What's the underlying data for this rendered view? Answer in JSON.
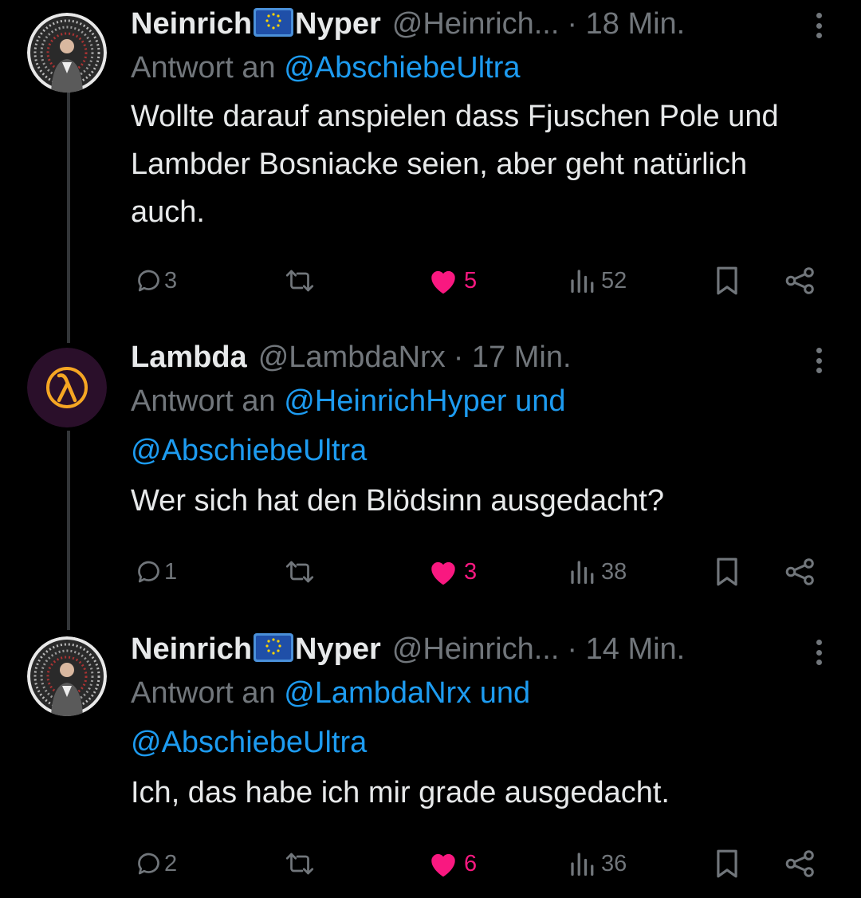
{
  "tweets": [
    {
      "name_a": "Neinrich",
      "name_b": "Nyper",
      "handle": "@Heinrich...",
      "time": "· 18 Min.",
      "reply_prefix": "Antwort an",
      "reply_mentions": "@AbschiebeUltra",
      "reply_line2": "",
      "text": "Wollte darauf anspielen dass Fjuschen Pole und Lambder Bosniacke seien, aber geht natürlich auch.",
      "replies": "3",
      "likes": "5",
      "views": "52",
      "avatar_icon": "avatar-dotted-circle-icon"
    },
    {
      "name_a": "Lambda",
      "handle": "@LambdaNrx",
      "time": "· 17 Min.",
      "reply_prefix": "Antwort an",
      "reply_mentions": "@HeinrichHyper und",
      "reply_line2": "@AbschiebeUltra",
      "text": "Wer sich hat den Blödsinn ausgedacht?",
      "replies": "1",
      "likes": "3",
      "views": "38",
      "avatar_icon": "lambda-icon"
    },
    {
      "name_a": "Neinrich",
      "name_b": "Nyper",
      "handle": "@Heinrich...",
      "time": "· 14 Min.",
      "reply_prefix": "Antwort an",
      "reply_mentions": "@LambdaNrx und",
      "reply_line2": "@AbschiebeUltra",
      "text": "Ich, das habe ich mir grade ausgedacht.",
      "replies": "2",
      "likes": "6",
      "views": "36",
      "avatar_icon": "avatar-dotted-circle-icon"
    }
  ],
  "colors": {
    "background": "#000000",
    "primary_text": "#e7e9ea",
    "secondary_text": "#71767b",
    "mention": "#1d9bf0",
    "like": "#f91880",
    "lambda_orange": "#f5a623"
  },
  "icons": [
    "reply-icon",
    "retweet-icon",
    "heart-icon",
    "views-icon",
    "bookmark-icon",
    "share-icon",
    "more-icon",
    "eu-flag-icon"
  ]
}
